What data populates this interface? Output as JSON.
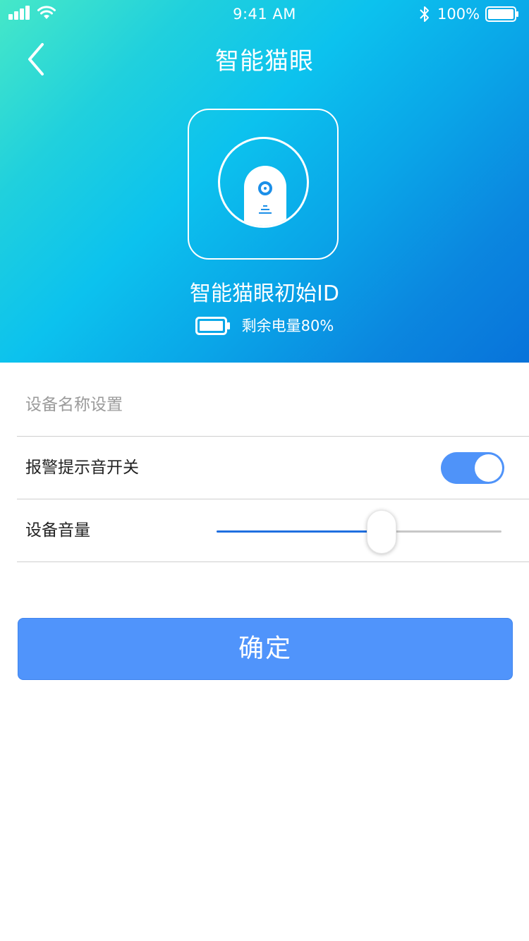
{
  "status_bar": {
    "time": "9:41 AM",
    "battery_percent": "100%"
  },
  "header": {
    "title": "智能猫眼",
    "back_icon": "chevron-left-icon"
  },
  "device": {
    "icon": "peephole-camera-icon",
    "name": "智能猫眼初始ID",
    "battery_label": "剩余电量80%",
    "battery_level": 0.8
  },
  "settings": {
    "name_field": {
      "placeholder": "设备名称设置",
      "value": ""
    },
    "alarm": {
      "label": "报警提示音开关",
      "enabled": true
    },
    "volume": {
      "label": "设备音量",
      "level": 0.58
    }
  },
  "confirm_label": "确定",
  "colors": {
    "gradient_start": "#46e8c8",
    "gradient_end": "#0873da",
    "accent": "#5094fb",
    "slider_fill": "#1f6fe0"
  }
}
